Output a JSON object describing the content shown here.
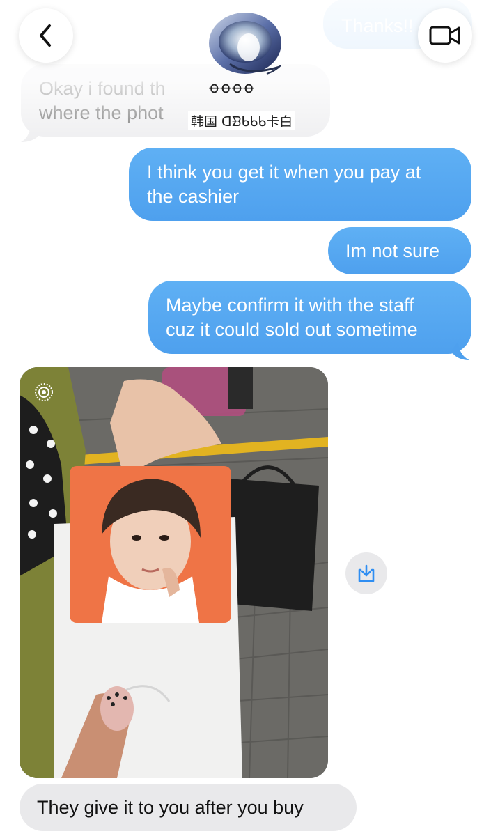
{
  "header": {
    "back_icon": "chevron-left-icon",
    "video_icon": "video-camera-icon",
    "avatar_icon": "chrome-ring-logo-icon",
    "name_line1": "ꝋꝋꝋꝋ",
    "name_line2": "韩国 ᗡᗿᑲᑲᑲ卡白"
  },
  "messages": {
    "prev_outgoing": "Thanks!!",
    "incoming_1_line1": "Okay i found th",
    "incoming_1_line2": "where the phot",
    "outgoing_1_line1": "I think you get it when you pay at",
    "outgoing_1_line2": "the cashier",
    "outgoing_2": "Im not sure",
    "outgoing_3_line1": "Maybe confirm it with the staff",
    "outgoing_3_line2": "cuz it could sold out sometime",
    "incoming_photo_alt": "photo-card-in-envelope",
    "incoming_2": "They give it to you after you buy"
  },
  "colors": {
    "outgoing_bubble": "#58a8f1",
    "incoming_bubble": "#e9e9eb",
    "accent_icon": "#2f8ef2"
  },
  "icons": {
    "download": "download-tray-icon",
    "live_photo": "live-photo-icon"
  }
}
